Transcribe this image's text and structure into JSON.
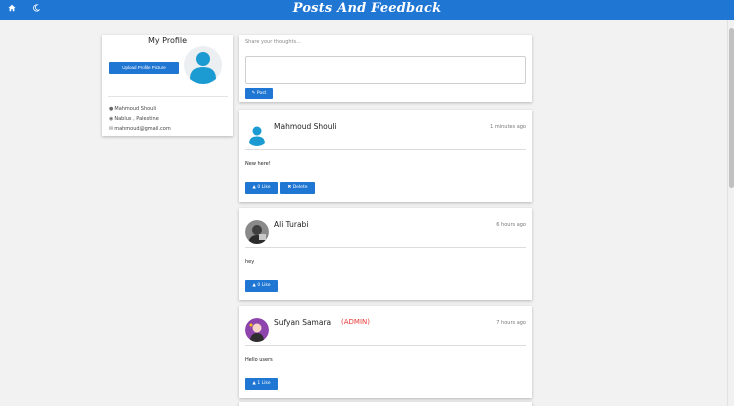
{
  "header": {
    "title": "Posts And Feedback",
    "home_icon": "home-icon",
    "theme_icon": "moon-icon",
    "color": "#1f76d3"
  },
  "profile": {
    "heading": "My Profile",
    "upload_label": "Upload Profile Picture",
    "name": "Mahmoud Shouli",
    "location": "Nablus , Palestine",
    "email": "mahmoud@gmail.com"
  },
  "composer": {
    "placeholder": "Share your thoughts...",
    "post_label": "Post"
  },
  "posts": [
    {
      "author": "Mahmoud Shouli",
      "role": "",
      "time": "1 minutes ago",
      "text": "New here!",
      "like_label": "0 Like",
      "delete_label": "Delete"
    },
    {
      "author": "Ali Turabi",
      "role": "",
      "time": "6 hours ago",
      "text": "hey",
      "like_label": "0 Like"
    },
    {
      "author": "Sufyan Samara",
      "role": "(ADMIN)",
      "time": "7 hours ago",
      "text": "Hello users",
      "like_label": "1 Like"
    }
  ]
}
